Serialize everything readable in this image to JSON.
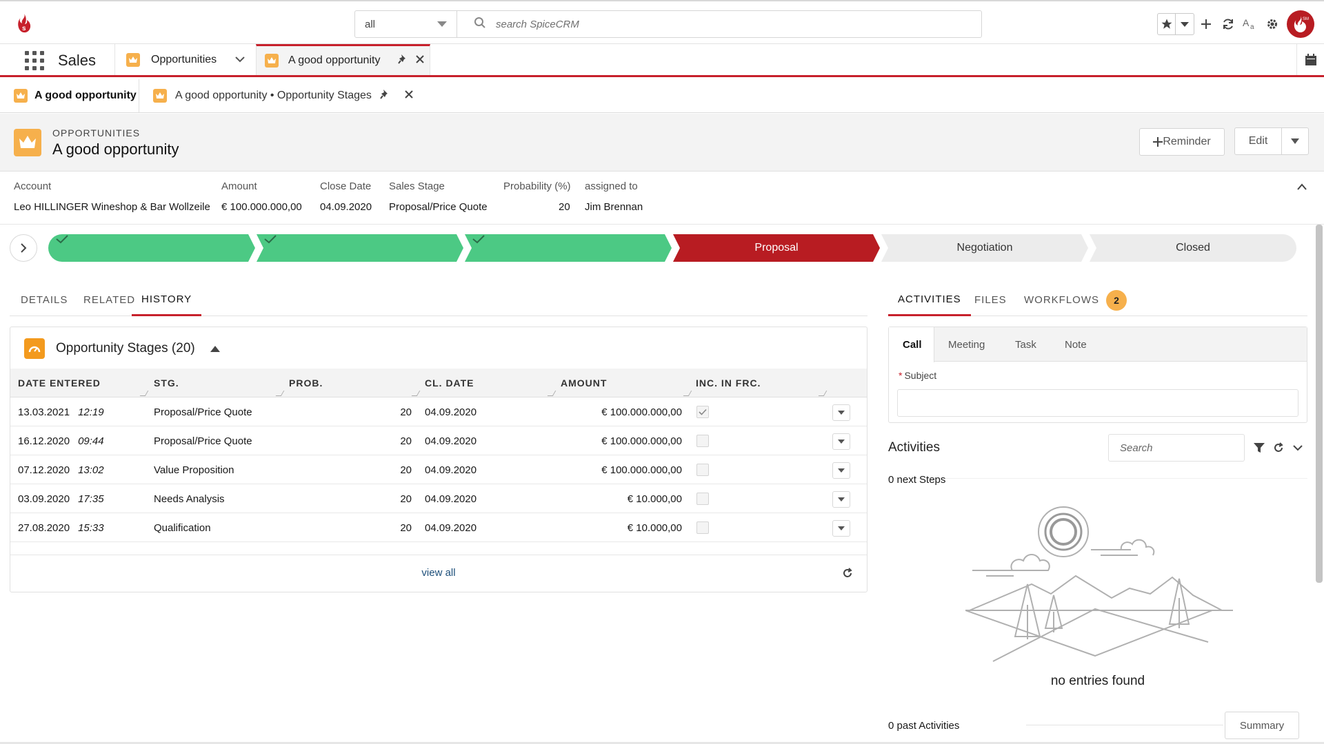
{
  "header": {
    "scope_value": "all",
    "search_placeholder": "search SpiceCRM",
    "avatar_initials": "SM"
  },
  "app": {
    "name": "Sales",
    "tabs": [
      {
        "label": "Opportunities",
        "active": false
      },
      {
        "label": "A good opportunity",
        "active": true
      }
    ]
  },
  "subtabs": [
    {
      "label": "A good opportunity",
      "active": true
    },
    {
      "label": "A good opportunity • Opportunity Stages",
      "active": false
    }
  ],
  "record": {
    "module": "OPPORTUNITIES",
    "title": "A good opportunity",
    "reminder_label": "Reminder",
    "edit_label": "Edit"
  },
  "highlights": [
    {
      "label": "Account",
      "value": "Leo HILLINGER Wineshop & Bar Wollzeile"
    },
    {
      "label": "Amount",
      "value": "€ 100.000.000,00"
    },
    {
      "label": "Close Date",
      "value": "04.09.2020"
    },
    {
      "label": "Sales Stage",
      "value": "Proposal/Price Quote"
    },
    {
      "label": "Probability (%)",
      "value": "20"
    },
    {
      "label": "assigned to",
      "value": "Jim Brennan"
    }
  ],
  "stages": [
    {
      "label": "",
      "state": "done"
    },
    {
      "label": "",
      "state": "done"
    },
    {
      "label": "",
      "state": "done"
    },
    {
      "label": "Proposal",
      "state": "current"
    },
    {
      "label": "Negotiation",
      "state": "open"
    },
    {
      "label": "Closed",
      "state": "open"
    }
  ],
  "left_tabs": [
    {
      "label": "DETAILS",
      "active": false
    },
    {
      "label": "RELATED",
      "active": false
    },
    {
      "label": "HISTORY",
      "active": true
    }
  ],
  "history": {
    "title": "Opportunity Stages (20)",
    "columns": [
      "DATE ENTERED",
      "STG.",
      "PROB.",
      "CL. DATE",
      "AMOUNT",
      "INC. IN FRC."
    ],
    "rows": [
      {
        "date": "13.03.2021",
        "time": "12:19",
        "stage": "Proposal/Price Quote",
        "prob": "20",
        "close": "04.09.2020",
        "amount": "€ 100.000.000,00",
        "included": true
      },
      {
        "date": "16.12.2020",
        "time": "09:44",
        "stage": "Proposal/Price Quote",
        "prob": "20",
        "close": "04.09.2020",
        "amount": "€ 100.000.000,00",
        "included": false
      },
      {
        "date": "07.12.2020",
        "time": "13:02",
        "stage": "Value Proposition",
        "prob": "20",
        "close": "04.09.2020",
        "amount": "€ 100.000.000,00",
        "included": false
      },
      {
        "date": "03.09.2020",
        "time": "17:35",
        "stage": "Needs Analysis",
        "prob": "20",
        "close": "04.09.2020",
        "amount": "€ 10.000,00",
        "included": false
      },
      {
        "date": "27.08.2020",
        "time": "15:33",
        "stage": "Qualification",
        "prob": "20",
        "close": "04.09.2020",
        "amount": "€ 10.000,00",
        "included": false
      }
    ],
    "view_all": "view all"
  },
  "right_tabs": [
    {
      "label": "ACTIVITIES",
      "active": true
    },
    {
      "label": "FILES",
      "active": false
    },
    {
      "label": "WORKFLOWS",
      "active": false,
      "badge": "2"
    }
  ],
  "composer": {
    "tabs": [
      "Call",
      "Meeting",
      "Task",
      "Note"
    ],
    "subject_label": "Subject",
    "required_mark": "*"
  },
  "activities": {
    "title": "Activities",
    "search_placeholder": "Search",
    "next_steps": "0 next Steps",
    "empty": "no entries found",
    "past": "0 past Activities",
    "summary_label": "Summary"
  },
  "colors": {
    "accent_red": "#c7202b",
    "stage_done": "#4cc984",
    "stage_current": "#b81c22",
    "stage_open": "#ececec",
    "module_orange": "#f6b04c"
  }
}
